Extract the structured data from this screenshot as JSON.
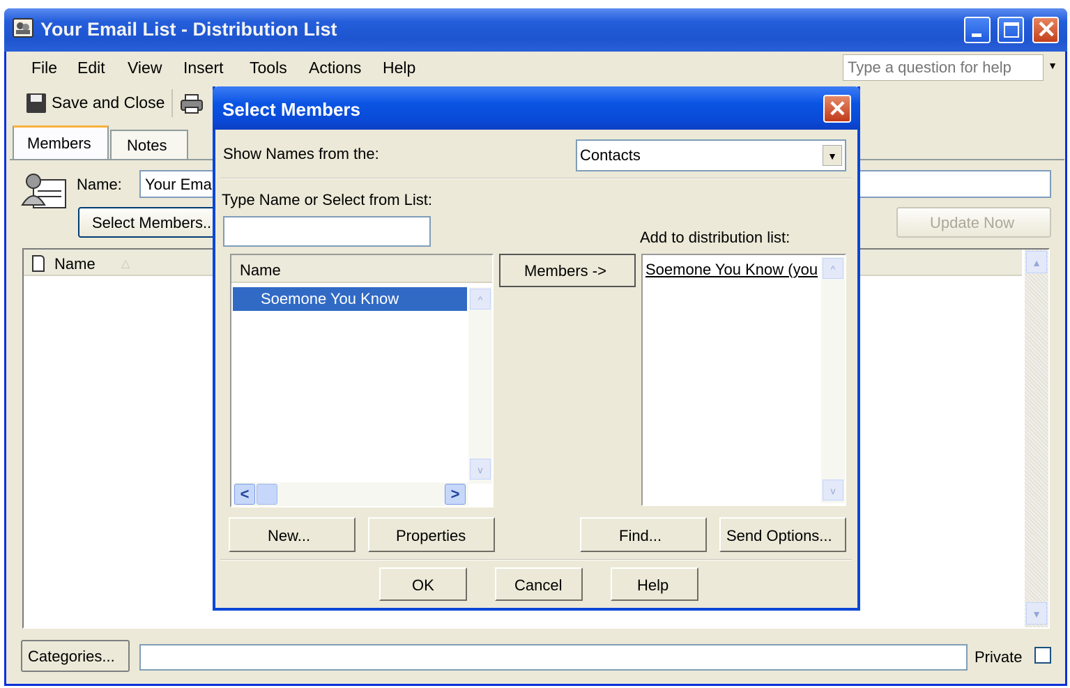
{
  "window": {
    "title": "Your Email List - Distribution List",
    "icon": "distribution-list-icon"
  },
  "menu": {
    "items": [
      "File",
      "Edit",
      "View",
      "Insert",
      "Tools",
      "Actions",
      "Help"
    ],
    "help_placeholder": "Type a question for help"
  },
  "toolbar": {
    "save_close_label": "Save and Close",
    "print_icon": "printer-icon"
  },
  "tabs": [
    "Members",
    "Notes"
  ],
  "form": {
    "name_label": "Name:",
    "name_value": "Your Email List",
    "select_members_label": "Select Members...",
    "update_now_label": "Update Now",
    "list_header_name": "Name",
    "categories_label": "Categories...",
    "private_label": "Private"
  },
  "dialog": {
    "title": "Select Members",
    "show_names_label": "Show Names from the:",
    "show_names_value": "Contacts",
    "type_name_label": "Type Name or Select from List:",
    "type_name_value": "",
    "list_header": "Name",
    "contacts": [
      "Soemone You Know"
    ],
    "members_button": "Members ->",
    "add_to_label": "Add to distribution list:",
    "added_members": [
      "Soemone You Know (you"
    ],
    "new_button": "New...",
    "properties_button": "Properties",
    "find_button": "Find...",
    "send_options_button": "Send Options...",
    "ok_button": "OK",
    "cancel_button": "Cancel",
    "help_button": "Help"
  }
}
